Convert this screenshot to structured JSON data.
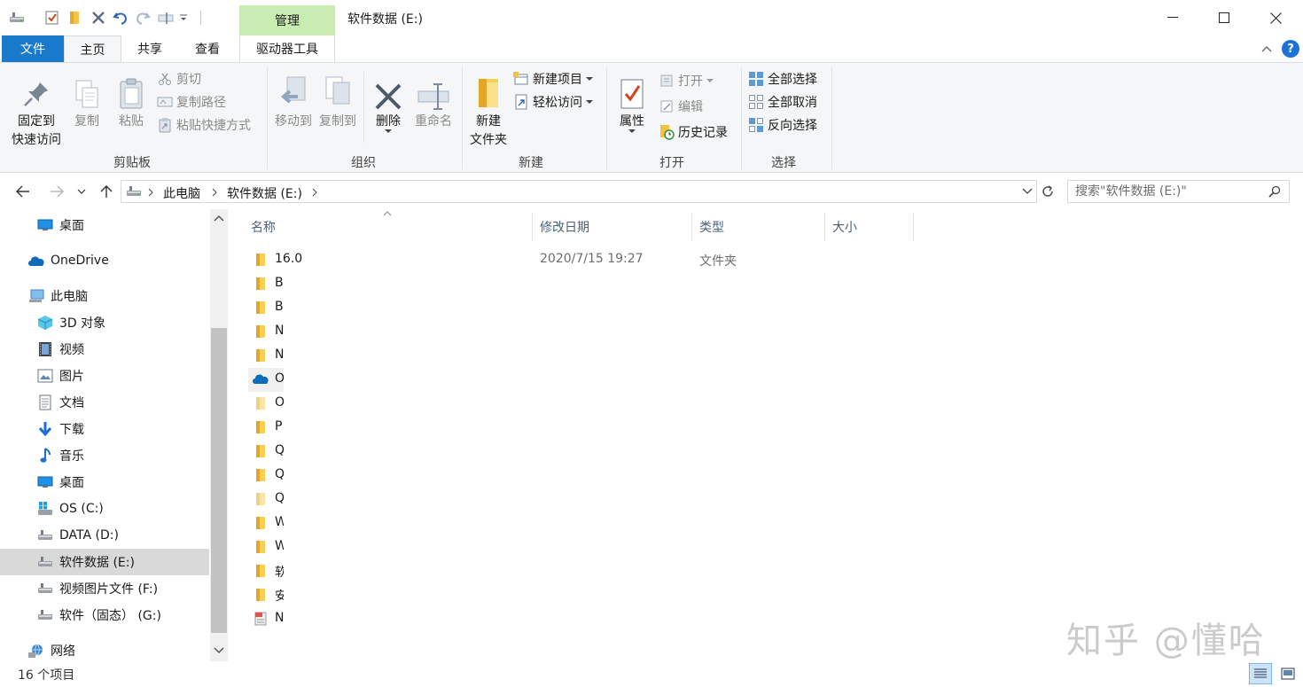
{
  "window": {
    "title": "软件数据 (E:)",
    "context_tab_group": "管理",
    "accent_color": "#1979ca",
    "context_color": "#c8ecb2"
  },
  "tabs": {
    "file": "文件",
    "home": "主页",
    "share": "共享",
    "view": "查看",
    "drive_tools": "驱动器工具"
  },
  "ribbon": {
    "clipboard": {
      "label": "剪贴板",
      "pin_line1": "固定到",
      "pin_line2": "快速访问",
      "copy": "复制",
      "paste": "粘贴",
      "cut": "剪切",
      "copy_path": "复制路径",
      "paste_shortcut": "粘贴快捷方式"
    },
    "organize": {
      "label": "组织",
      "move_to": "移动到",
      "copy_to": "复制到",
      "delete": "删除",
      "rename": "重命名"
    },
    "new": {
      "label": "新建",
      "new_folder_line1": "新建",
      "new_folder_line2": "文件夹",
      "new_item": "新建项目",
      "easy_access": "轻松访问"
    },
    "open": {
      "label": "打开",
      "properties": "属性",
      "open": "打开",
      "edit": "编辑",
      "history": "历史记录"
    },
    "select": {
      "label": "选择",
      "select_all": "全部选择",
      "select_none": "全部取消",
      "invert": "反向选择"
    }
  },
  "address": {
    "crumbs": [
      "此电脑",
      "软件数据 (E:)"
    ],
    "search_placeholder": "搜索\"软件数据 (E:)\""
  },
  "nav": {
    "items": [
      {
        "label": "桌面",
        "icon": "desktop-icon"
      },
      {
        "label": "OneDrive",
        "icon": "onedrive-icon"
      },
      {
        "label": "此电脑",
        "icon": "pc-icon"
      },
      {
        "label": "3D 对象",
        "icon": "3d-objects-icon"
      },
      {
        "label": "视频",
        "icon": "video-icon"
      },
      {
        "label": "图片",
        "icon": "pictures-icon"
      },
      {
        "label": "文档",
        "icon": "documents-icon"
      },
      {
        "label": "下载",
        "icon": "download-icon"
      },
      {
        "label": "音乐",
        "icon": "music-icon"
      },
      {
        "label": "桌面",
        "icon": "desktop-icon"
      },
      {
        "label": "OS (C:)",
        "icon": "windows-drive-icon"
      },
      {
        "label": "DATA (D:)",
        "icon": "drive-icon"
      },
      {
        "label": "软件数据 (E:)",
        "icon": "drive-icon"
      },
      {
        "label": "视频图片文件 (F:)",
        "icon": "drive-icon"
      },
      {
        "label": "软件（固态） (G:)",
        "icon": "drive-icon"
      },
      {
        "label": "网络",
        "icon": "network-icon"
      }
    ]
  },
  "files": {
    "columns": {
      "name": "名称",
      "modified": "修改日期",
      "type": "类型",
      "size": "大小"
    },
    "first_row": {
      "name": "16.0",
      "modified": "2020/7/15 19:27",
      "type": "文件夹"
    },
    "rows": [
      {
        "glyph": "B",
        "icon": "folder-icon"
      },
      {
        "glyph": "B",
        "icon": "folder-icon"
      },
      {
        "glyph": "N",
        "icon": "folder-icon"
      },
      {
        "glyph": "N",
        "icon": "folder-icon"
      },
      {
        "glyph": "O",
        "icon": "onedrive-folder-icon"
      },
      {
        "glyph": "O",
        "icon": "folder-faded-icon"
      },
      {
        "glyph": "P",
        "icon": "folder-icon"
      },
      {
        "glyph": "Q",
        "icon": "folder-icon"
      },
      {
        "glyph": "Q",
        "icon": "folder-icon"
      },
      {
        "glyph": "Q",
        "icon": "folder-faded-icon"
      },
      {
        "glyph": "W",
        "icon": "folder-icon"
      },
      {
        "glyph": "W",
        "icon": "folder-icon"
      },
      {
        "glyph": "软",
        "icon": "folder-icon"
      },
      {
        "glyph": "安",
        "icon": "folder-icon"
      },
      {
        "glyph": "N",
        "icon": "language-file-icon"
      }
    ]
  },
  "status": {
    "count": "16 个项目"
  },
  "watermark": "知乎 @懂哈"
}
